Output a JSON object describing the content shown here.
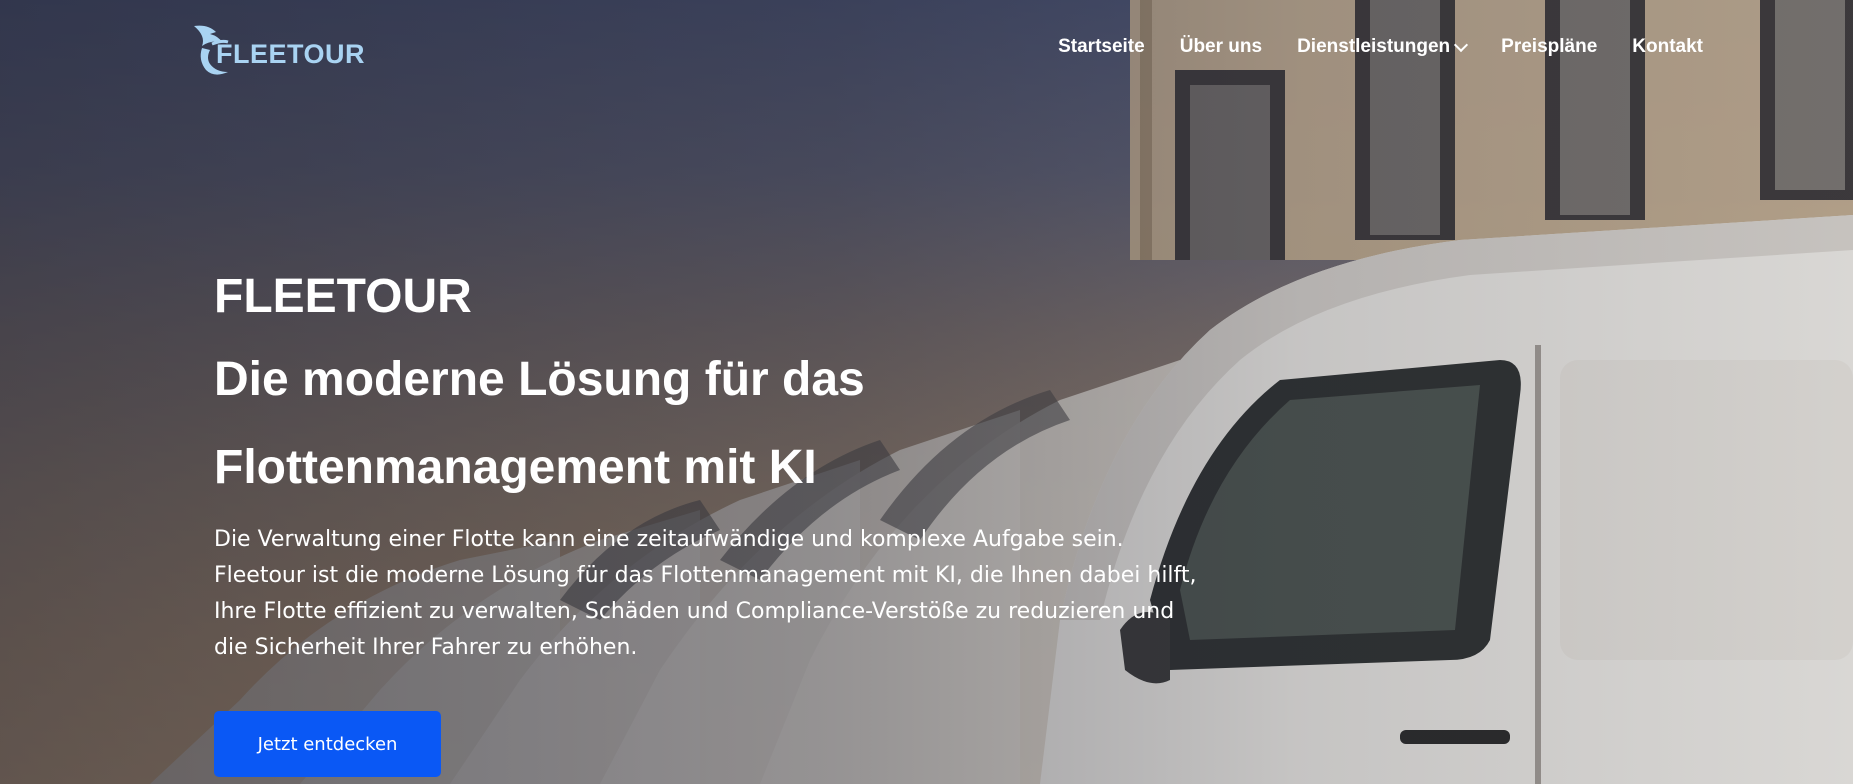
{
  "header": {
    "logo_text": "FLEETOUR",
    "logo_icon": "bird-wing-logo-icon",
    "nav": [
      {
        "label": "Startseite"
      },
      {
        "label": "Über uns"
      },
      {
        "label": "Dienstleistungen",
        "icon": "chevron-down-icon"
      },
      {
        "label": "Preispläne"
      },
      {
        "label": "Kontakt"
      }
    ]
  },
  "hero": {
    "brand": "FLEETOUR",
    "headline": "Die moderne Lösung für das Flottenmanagement mit KI",
    "description": "Die Verwaltung einer Flotte kann eine zeitaufwändige und komplexe Aufgabe sein. Fleetour ist die moderne Lösung für das Flottenmanagement mit KI, die Ihnen dabei hilft, Ihre Flotte effizient zu verwalten, Schäden und Compliance-Verstöße zu reduzieren und die Sicherheit Ihrer Fahrer zu erhöhen.",
    "cta_label": "Jetzt entdecken",
    "background": "row-of-white-vans-at-sunset"
  },
  "colors": {
    "cta_background": "#0a58f5",
    "logo_color": "#a9d3f2",
    "text": "#ffffff"
  }
}
